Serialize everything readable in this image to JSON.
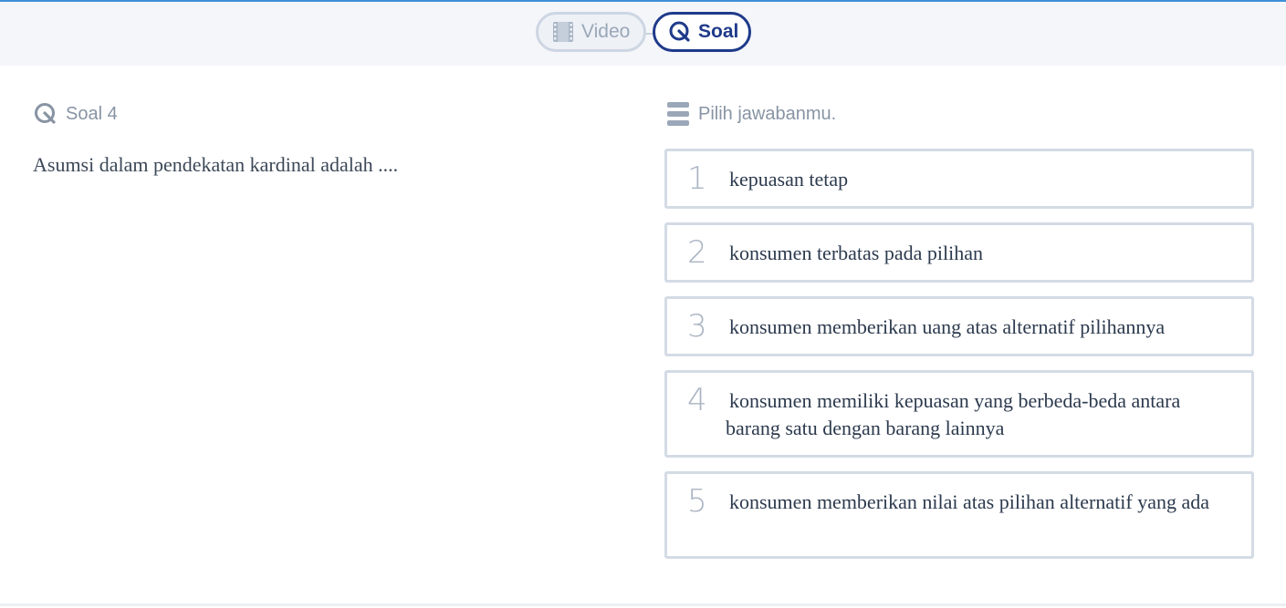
{
  "tabs": {
    "video": {
      "label": "Video",
      "icon": "film-icon"
    },
    "soal": {
      "label": "Soal",
      "icon": "quiz-icon",
      "active": true
    }
  },
  "question": {
    "header": "Soal 4",
    "text": "Asumsi dalam pendekatan kardinal adalah ...."
  },
  "answers": {
    "header": "Pilih jawabanmu.",
    "options": [
      {
        "number": "1",
        "text": "kepuasan tetap"
      },
      {
        "number": "2",
        "text": "konsumen terbatas pada pilihan"
      },
      {
        "number": "3",
        "text": "konsumen memberikan uang atas alternatif pilihannya"
      },
      {
        "number": "4",
        "text": "konsumen memiliki kepuasan yang berbeda-beda antara barang satu dengan barang lainnya"
      },
      {
        "number": "5",
        "text": "konsumen memberikan nilai atas pilihan alternatif yang ada"
      }
    ]
  },
  "colors": {
    "accent": "#1f3a8a",
    "top_bar": "#f5f6fa",
    "border": "#d3dbe5",
    "muted_text": "#8894a4"
  }
}
